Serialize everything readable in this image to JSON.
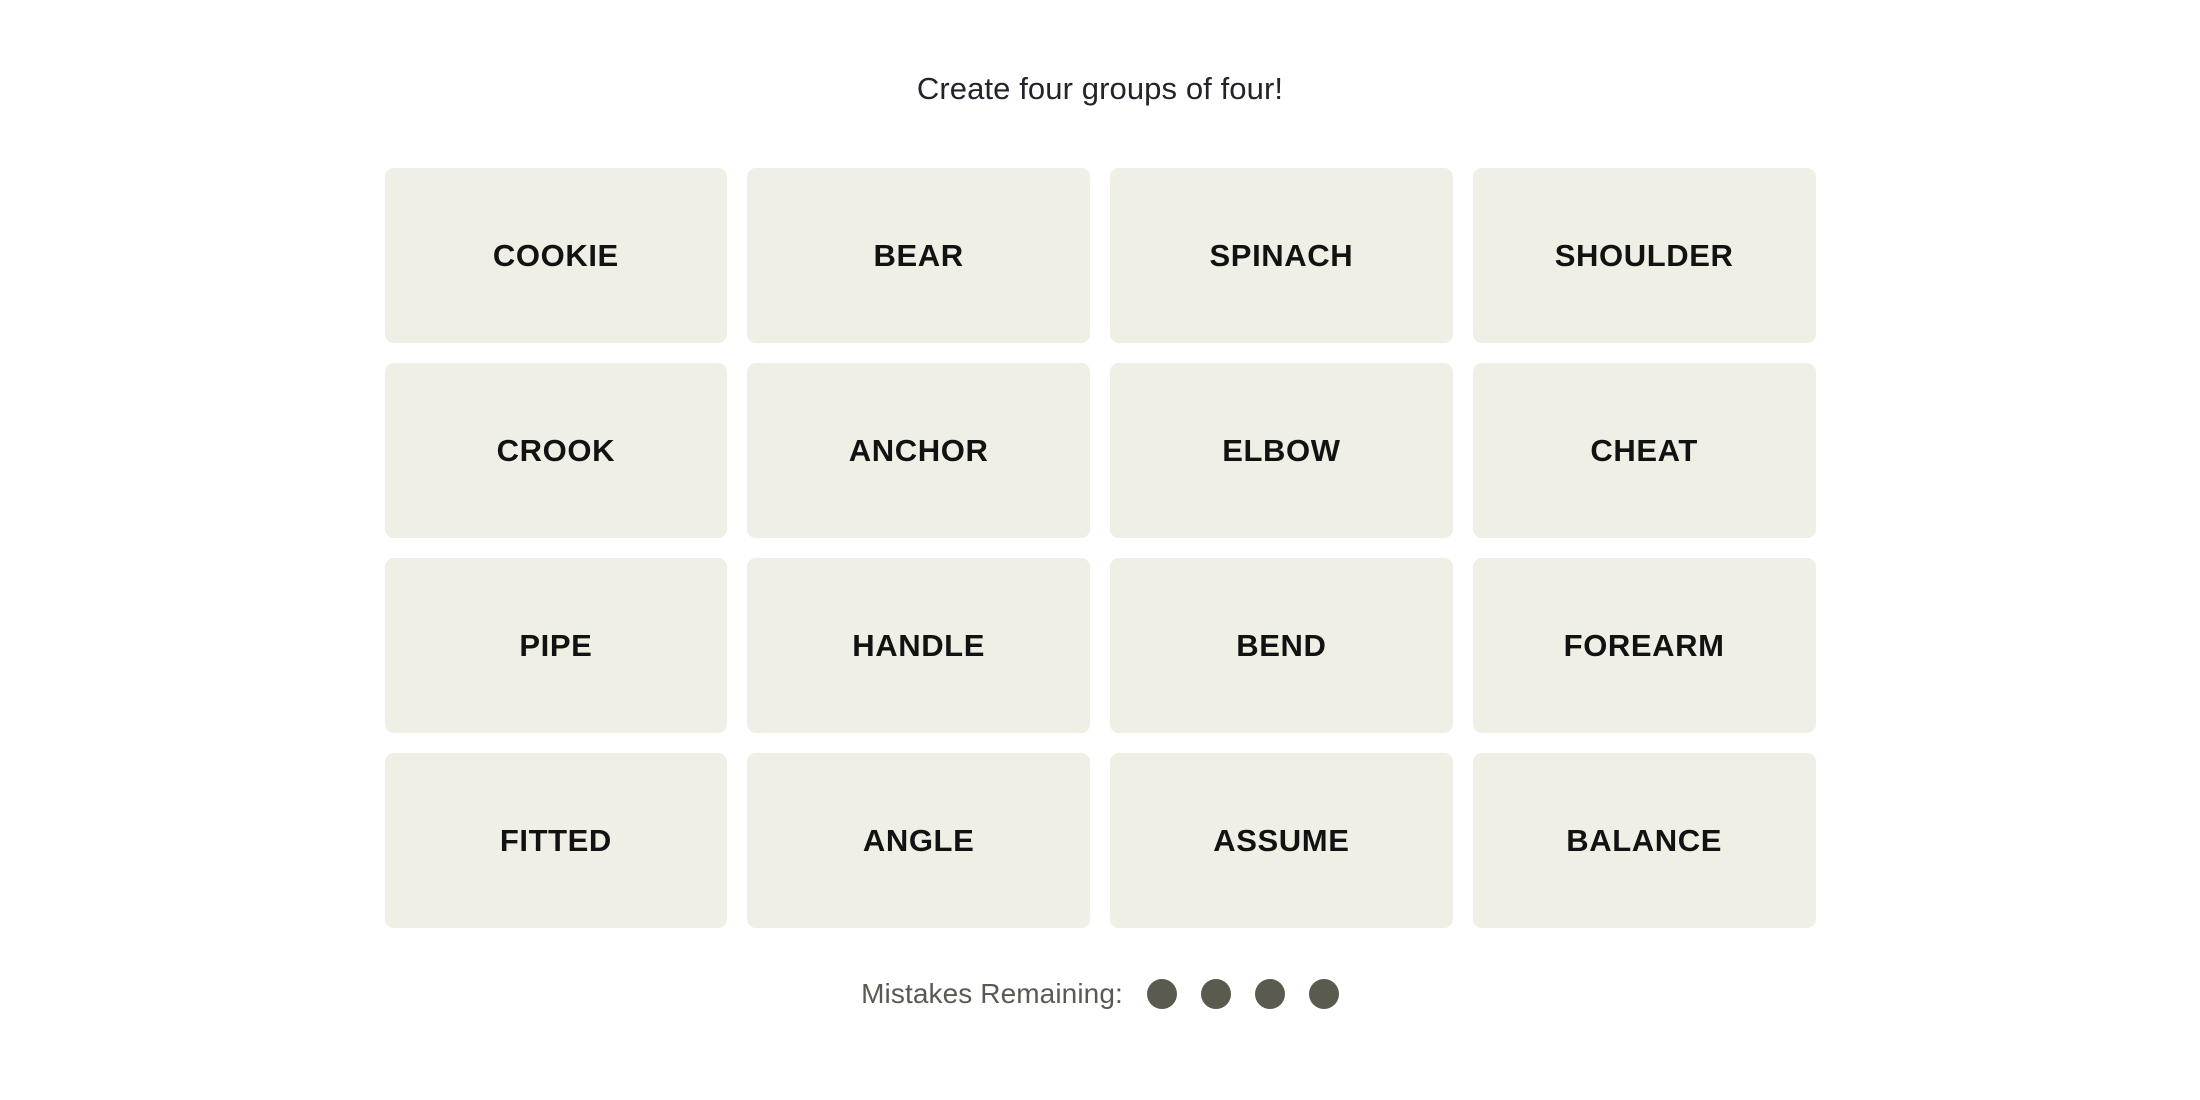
{
  "game": {
    "instruction": "Create four groups of four!",
    "tile_bg_color": "#EFEFE6",
    "tile_text_color": "#121212",
    "page_bg_color": "#FFFFFF",
    "instruction_color": "#23232B",
    "mistake_dot_color": "#5A5A4E",
    "mistakes_label_color": "#5A5A50"
  },
  "grid": {
    "rows": 4,
    "columns": 4,
    "tiles": [
      {
        "label": "COOKIE",
        "row": 1,
        "col": 1,
        "selected": false
      },
      {
        "label": "BEAR",
        "row": 1,
        "col": 2,
        "selected": false
      },
      {
        "label": "SPINACH",
        "row": 1,
        "col": 3,
        "selected": false
      },
      {
        "label": "SHOULDER",
        "row": 1,
        "col": 4,
        "selected": false
      },
      {
        "label": "CROOK",
        "row": 2,
        "col": 1,
        "selected": false
      },
      {
        "label": "ANCHOR",
        "row": 2,
        "col": 2,
        "selected": false
      },
      {
        "label": "ELBOW",
        "row": 2,
        "col": 3,
        "selected": false
      },
      {
        "label": "CHEAT",
        "row": 2,
        "col": 4,
        "selected": false
      },
      {
        "label": "PIPE",
        "row": 3,
        "col": 1,
        "selected": false
      },
      {
        "label": "HANDLE",
        "row": 3,
        "col": 2,
        "selected": false
      },
      {
        "label": "BEND",
        "row": 3,
        "col": 3,
        "selected": false
      },
      {
        "label": "FOREARM",
        "row": 3,
        "col": 4,
        "selected": false
      },
      {
        "label": "FITTED",
        "row": 4,
        "col": 1,
        "selected": false
      },
      {
        "label": "ANGLE",
        "row": 4,
        "col": 2,
        "selected": false
      },
      {
        "label": "ASSUME",
        "row": 4,
        "col": 3,
        "selected": false
      },
      {
        "label": "BALANCE",
        "row": 4,
        "col": 4,
        "selected": false
      }
    ]
  },
  "mistakes": {
    "label": "Mistakes Remaining:",
    "remaining": 4,
    "dots": [
      {
        "filled": true
      },
      {
        "filled": true
      },
      {
        "filled": true
      },
      {
        "filled": true
      }
    ]
  }
}
